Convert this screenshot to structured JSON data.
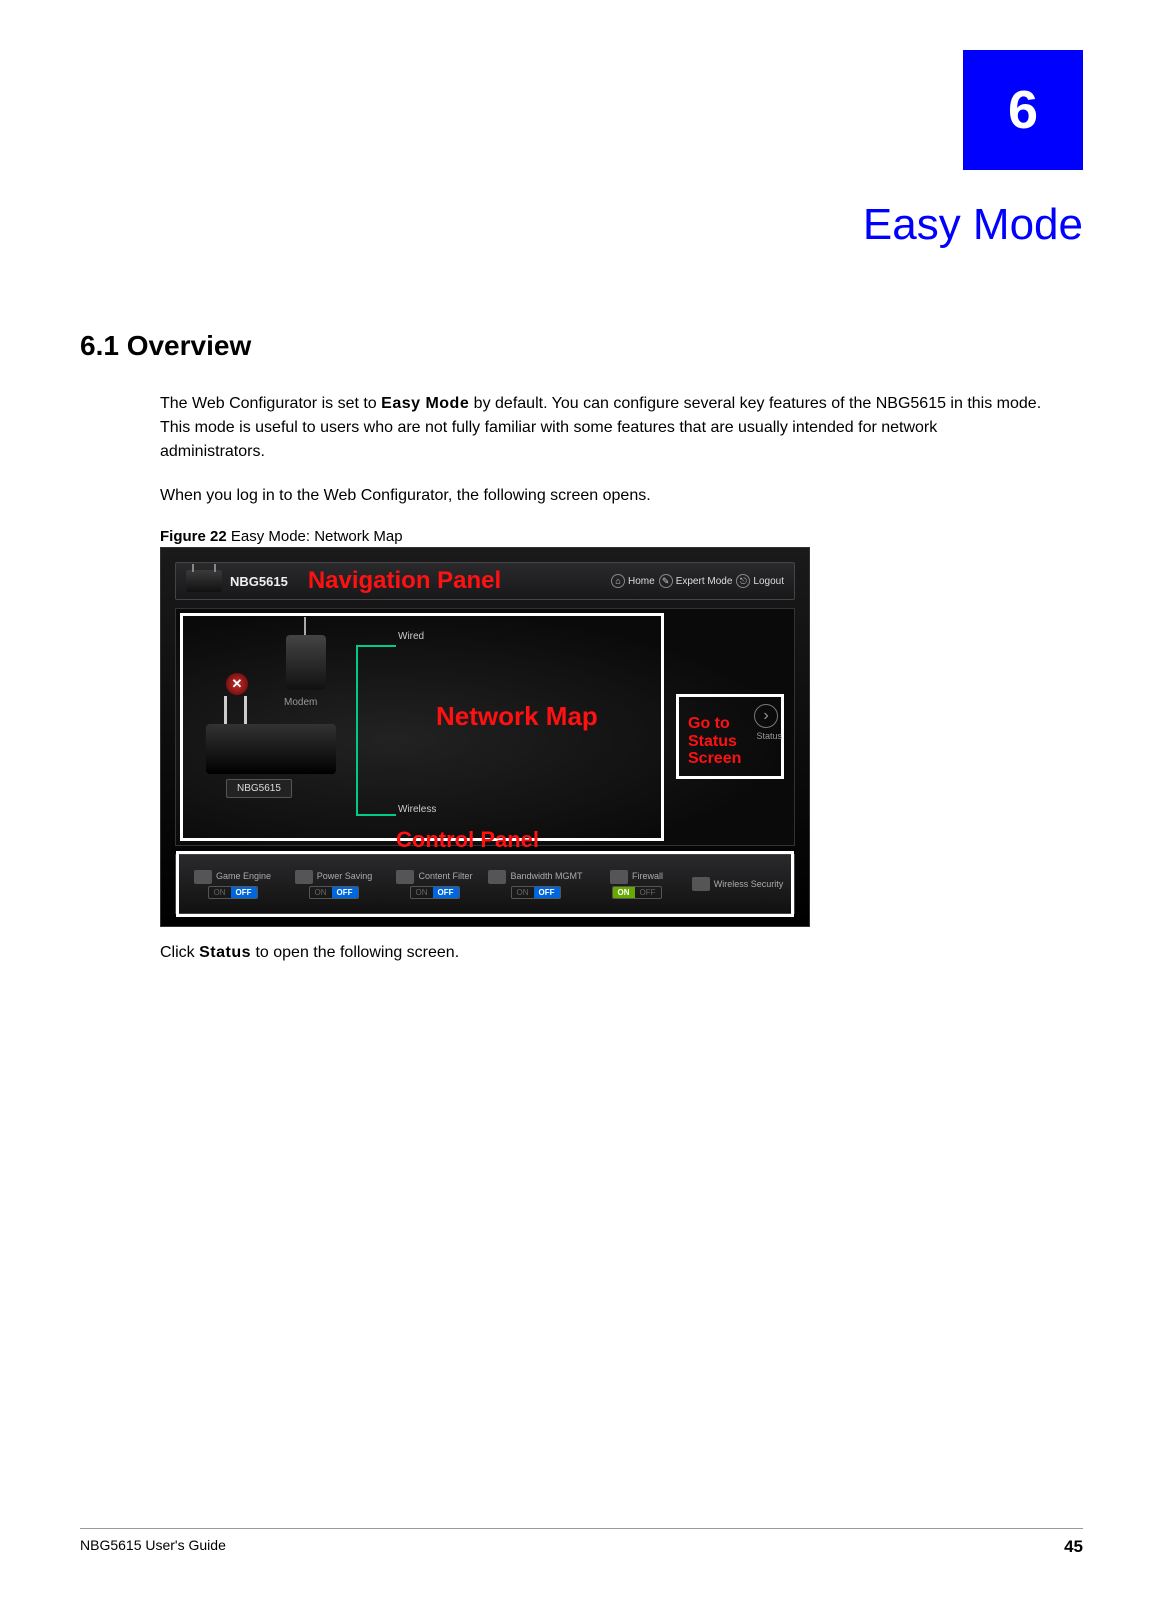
{
  "chapter": {
    "number": "6",
    "title": "Easy Mode"
  },
  "section_6_1": {
    "heading": "6.1  Overview"
  },
  "body": {
    "p1_a": "The Web Configurator is set to ",
    "p1_bold": "Easy Mode",
    "p1_b": " by default. You can configure several key features of the NBG5615 in this mode. This mode is useful to users who are not fully familiar with some features that are usually intended for network administrators.",
    "p2": "When you log in to the Web Configurator, the following screen opens.",
    "p3_a": "Click ",
    "p3_bold": "Status",
    "p3_b": " to open the following screen."
  },
  "figure": {
    "label": "Figure 22",
    "caption": "   Easy Mode: Network Map"
  },
  "screenshot": {
    "model": "NBG5615",
    "top_links": {
      "home": "Home",
      "expert": "Expert Mode",
      "logout": "Logout"
    },
    "labels": {
      "modem": "Modem",
      "wired": "Wired",
      "wireless": "Wireless",
      "nbg": "NBG5615",
      "status": "Status"
    },
    "annotations": {
      "navigation_panel": "Navigation Panel",
      "network_map": "Network Map",
      "go_to_status": "Go to Status Screen",
      "control_panel": "Control Panel"
    },
    "control_items": [
      {
        "name": "Game Engine",
        "state": "OFF"
      },
      {
        "name": "Power Saving",
        "state": "OFF"
      },
      {
        "name": "Content Filter",
        "state": "OFF"
      },
      {
        "name": "Bandwidth MGMT",
        "state": "OFF"
      },
      {
        "name": "Firewall",
        "state": "ON"
      },
      {
        "name": "Wireless Security",
        "state": ""
      }
    ],
    "toggle_labels": {
      "on": "ON",
      "off": "OFF"
    }
  },
  "footer": {
    "guide": "NBG5615 User's Guide",
    "page": "45"
  }
}
